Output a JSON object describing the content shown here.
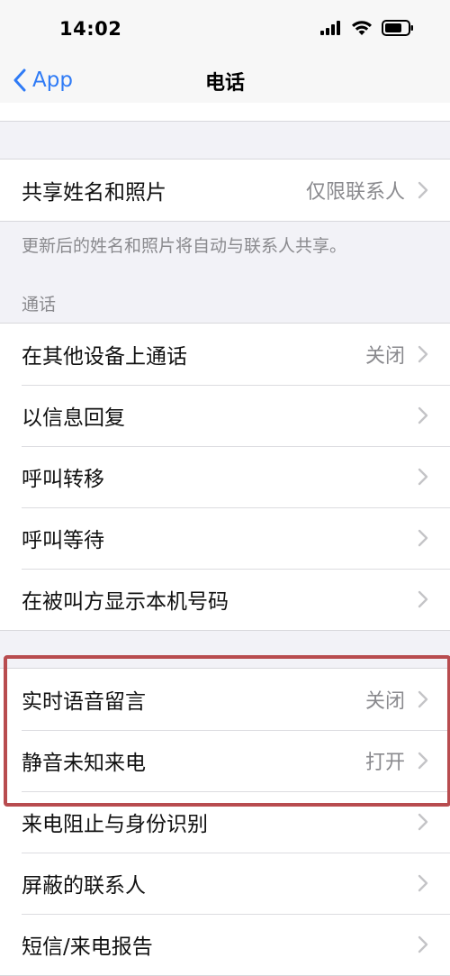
{
  "status_bar": {
    "time": "14:02"
  },
  "nav": {
    "back_label": "App",
    "title": "电话"
  },
  "group_share": {
    "rows": [
      {
        "label": "共享姓名和照片",
        "value": "仅限联系人"
      }
    ],
    "footnote": "更新后的姓名和照片将自动与联系人共享。"
  },
  "calls_section": {
    "header": "通话",
    "rows": [
      {
        "label": "在其他设备上通话",
        "value": "关闭"
      },
      {
        "label": "以信息回复",
        "value": ""
      },
      {
        "label": "呼叫转移",
        "value": ""
      },
      {
        "label": "呼叫等待",
        "value": ""
      },
      {
        "label": "在被叫方显示本机号码",
        "value": ""
      }
    ]
  },
  "group_voicemail": {
    "rows": [
      {
        "label": "实时语音留言",
        "value": "关闭"
      },
      {
        "label": "静音未知来电",
        "value": "打开"
      },
      {
        "label": "来电阻止与身份识别",
        "value": ""
      },
      {
        "label": "屏蔽的联系人",
        "value": ""
      },
      {
        "label": "短信/来电报告",
        "value": ""
      }
    ]
  },
  "colors": {
    "accent": "#2f7bf6",
    "highlight_border": "#b84c4f",
    "secondary_text": "#8a8a8e",
    "background": "#f2f2f7"
  },
  "icons": {
    "back": "chevron-left-icon",
    "row_disclosure": "chevron-right-icon",
    "signal": "signal-icon",
    "wifi": "wifi-icon",
    "battery": "battery-icon"
  }
}
